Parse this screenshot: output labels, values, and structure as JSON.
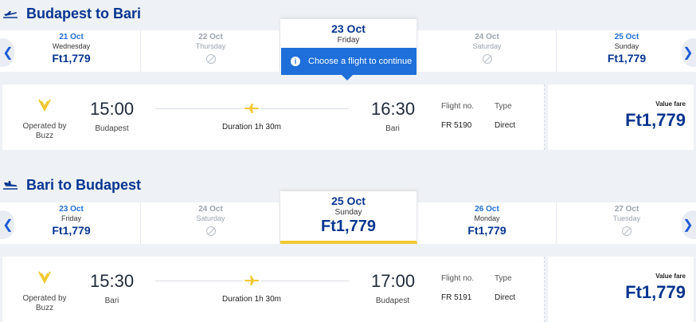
{
  "outbound": {
    "title": "Budapest to Bari",
    "dates": [
      {
        "date": "21 Oct",
        "weekday": "Wednesday",
        "price": "Ft1,779",
        "available": true
      },
      {
        "date": "22 Oct",
        "weekday": "Thursday",
        "price": "",
        "available": false
      },
      {
        "date": "23 Oct",
        "weekday": "Friday",
        "price": "",
        "available": true,
        "selected": true
      },
      {
        "date": "24 Oct",
        "weekday": "Saturday",
        "price": "",
        "available": false
      },
      {
        "date": "25 Oct",
        "weekday": "Sunday",
        "price": "Ft1,779",
        "available": true
      }
    ],
    "tooltip": "Choose a flight to continue",
    "flight": {
      "operated_by": "Operated by Buzz",
      "dep_time": "15:00",
      "dep_city": "Budapest",
      "duration": "Duration 1h 30m",
      "arr_time": "16:30",
      "arr_city": "Bari",
      "flight_no_label": "Flight no.",
      "flight_no": "FR 5190",
      "type_label": "Type",
      "type": "Direct",
      "fare_label": "Value fare",
      "fare": "Ft1,779"
    }
  },
  "return": {
    "title": "Bari to Budapest",
    "dates": [
      {
        "date": "23 Oct",
        "weekday": "Friday",
        "price": "Ft1,779",
        "available": true
      },
      {
        "date": "24 Oct",
        "weekday": "Saturday",
        "price": "",
        "available": false
      },
      {
        "date": "25 Oct",
        "weekday": "Sunday",
        "price": "Ft1,779",
        "available": true,
        "selected": true
      },
      {
        "date": "26 Oct",
        "weekday": "Monday",
        "price": "Ft1,779",
        "available": true
      },
      {
        "date": "27 Oct",
        "weekday": "Tuesday",
        "price": "",
        "available": false
      }
    ],
    "flight": {
      "operated_by": "Operated by Buzz",
      "dep_time": "15:30",
      "dep_city": "Bari",
      "duration": "Duration 1h 30m",
      "arr_time": "17:00",
      "arr_city": "Budapest",
      "flight_no_label": "Flight no.",
      "flight_no": "FR 5191",
      "type_label": "Type",
      "type": "Direct",
      "fare_label": "Value fare",
      "fare": "Ft1,779"
    }
  },
  "colors": {
    "brand": "#073590",
    "accent": "#1e6fd9",
    "highlight": "#f1c933"
  },
  "icons": {
    "outbound": "plane-takeoff-icon",
    "return": "plane-landing-icon",
    "prev": "chevron-left-icon",
    "next": "chevron-right-icon",
    "info": "info-icon",
    "no_flight": "no-flight-icon",
    "airline": "airline-logo"
  }
}
